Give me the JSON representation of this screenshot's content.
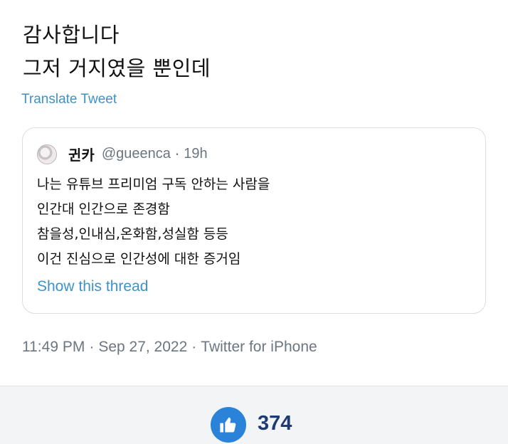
{
  "tweet": {
    "lines": [
      "감사합니다",
      "그저 거지였을 뿐인데"
    ],
    "translate_label": "Translate Tweet"
  },
  "quote": {
    "avatar_icon": "user-avatar-icon",
    "display_name": "귄카",
    "handle": "@gueenca",
    "separator": "·",
    "time": "19h",
    "lines": [
      "나는 유튜브 프리미엄 구독 안하는 사람을",
      "인간대 인간으로 존경함",
      "참을성,인내심,온화함,성실함 등등",
      "이건 진심으로 인간성에 대한 증거임"
    ],
    "show_thread": "Show this thread"
  },
  "meta": {
    "time": "11:49 PM",
    "separator": "·",
    "date": "Sep 27, 2022",
    "source": "Twitter for iPhone"
  },
  "reaction": {
    "icon": "thumbs-up-icon",
    "count": "374",
    "accent": "#2a83d8"
  }
}
